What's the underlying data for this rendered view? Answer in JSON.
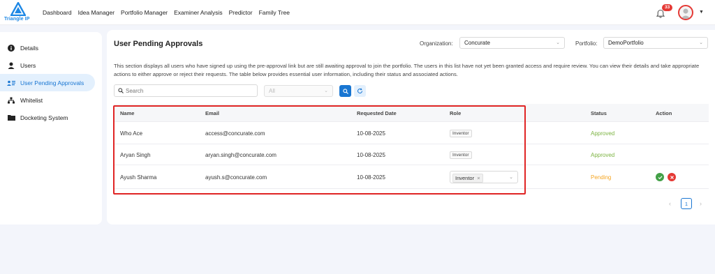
{
  "app": {
    "logo_text": "Triangle IP"
  },
  "nav": [
    "Dashboard",
    "Idea Manager",
    "Portfolio Manager",
    "Examiner Analysis",
    "Predictor",
    "Family Tree"
  ],
  "notifications": {
    "count": "33"
  },
  "sidebar": {
    "items": [
      {
        "label": "Details",
        "icon": "info-icon",
        "active": false
      },
      {
        "label": "Users",
        "icon": "user-icon",
        "active": false
      },
      {
        "label": "User Pending Approvals",
        "icon": "user-card-icon",
        "active": true
      },
      {
        "label": "Whitelist",
        "icon": "network-icon",
        "active": false
      },
      {
        "label": "Docketing System",
        "icon": "folder-icon",
        "active": false
      }
    ]
  },
  "header": {
    "title": "User Pending Approvals",
    "organization_label": "Organization:",
    "organization_value": "Concurate",
    "portfolio_label": "Portfolio:",
    "portfolio_value": "DemoPortfolio"
  },
  "description": "This section displays all users who have signed up using the pre-approval link but are still awaiting approval to join the portfolio. The users in this list have not yet been granted access and require review. You can view their details and take appropriate actions to either approve or reject their requests. The table below provides essential user information, including their status and associated actions.",
  "filters": {
    "search_placeholder": "Search",
    "status_value": "All"
  },
  "table": {
    "columns": [
      "Name",
      "Email",
      "Requested Date",
      "Role",
      "Status",
      "Action"
    ],
    "rows": [
      {
        "name": "Who Ace",
        "email": "access@concurate.com",
        "date": "10-08-2025",
        "role": "Inventor",
        "status": "Approved"
      },
      {
        "name": "Aryan Singh",
        "email": "aryan.singh@concurate.com",
        "date": "10-08-2025",
        "role": "Inventor",
        "status": "Approved"
      },
      {
        "name": "Ayush Sharma",
        "email": "ayush.s@concurate.com",
        "date": "10-08-2025",
        "role": "Inventor",
        "status": "Pending"
      }
    ]
  },
  "pagination": {
    "current": "1"
  },
  "colors": {
    "accent": "#1976d2",
    "approved": "#7cb342",
    "pending": "#f5a623",
    "reject": "#e53935",
    "approve": "#43a047",
    "highlight": "#e02424"
  }
}
